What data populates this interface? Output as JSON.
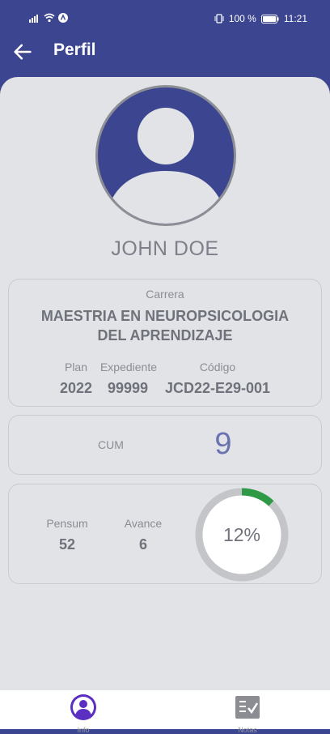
{
  "status_bar": {
    "battery_percent": "100 %",
    "time": "11:21"
  },
  "appbar": {
    "title": "Perfil"
  },
  "profile": {
    "name": "JOHN DOE"
  },
  "career": {
    "label": "Carrera",
    "value": "MAESTRIA EN NEUROPSICOLOGIA DEL APRENDIZAJE",
    "plan_label": "Plan",
    "plan_value": "2022",
    "expediente_label": "Expediente",
    "expediente_value": "99999",
    "codigo_label": "Código",
    "codigo_value": "JCD22-E29-001"
  },
  "cum": {
    "label": "CUM",
    "value": "9"
  },
  "progress": {
    "pensum_label": "Pensum",
    "pensum_value": "52",
    "avance_label": "Avance",
    "avance_value": "6",
    "percent_text": "12%",
    "percent": 0.12,
    "ring_color": "#2e9a45",
    "track_color": "#c4c5c9"
  },
  "bottom_nav": {
    "items": [
      {
        "label": "Info",
        "icon": "person-circle-icon",
        "active": true
      },
      {
        "label": "Notas",
        "icon": "grades-checklist-icon",
        "active": false
      }
    ]
  },
  "colors": {
    "primary": "#3b4590",
    "background": "#e1e3e6",
    "accent": "#5a2fc2"
  }
}
